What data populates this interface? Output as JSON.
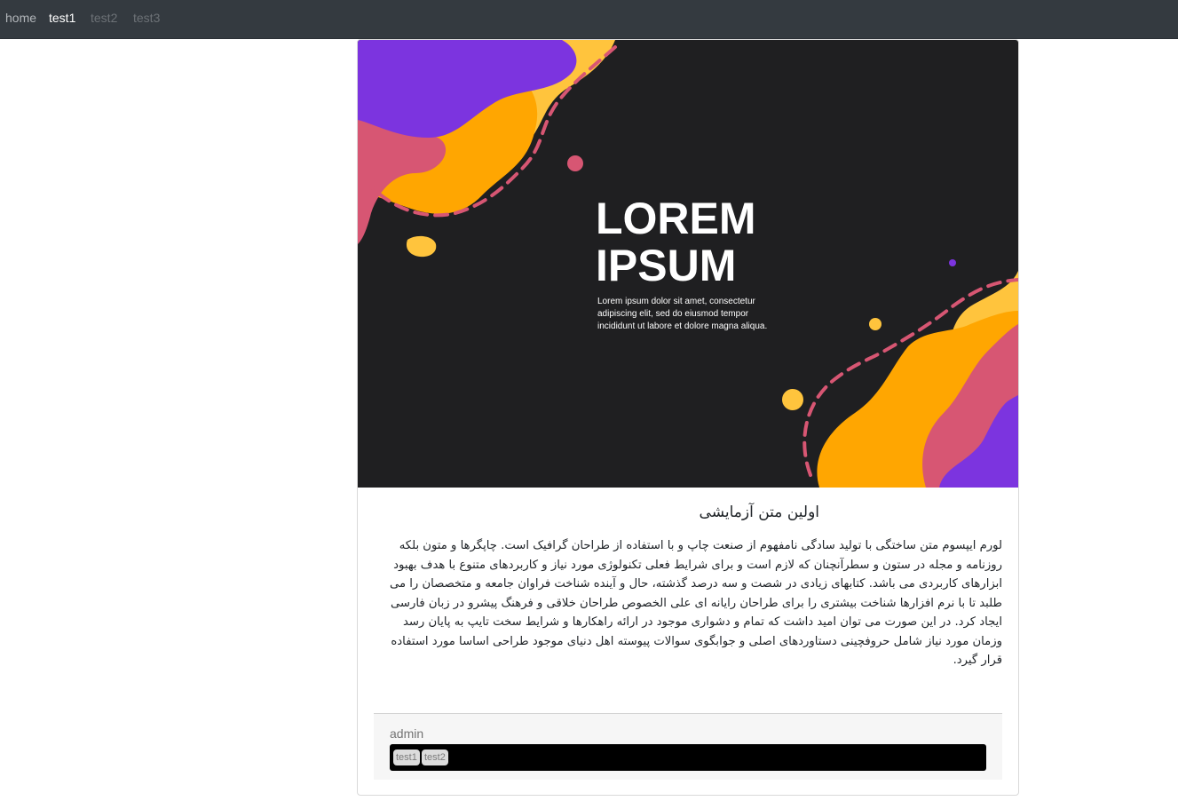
{
  "nav": {
    "home": "home",
    "items": [
      "test1",
      "test2",
      "test3"
    ]
  },
  "card": {
    "image": {
      "headline_1": "LOREM",
      "headline_2": "IPSUM",
      "caption": [
        "Lorem ipsum dolor sit amet, consectetur",
        "adipiscing elit, sed do eiusmod tempor",
        "incididunt ut labore et dolore magna aliqua."
      ],
      "colors": {
        "background": "#1f1f21",
        "purple": "#7c34df",
        "orange": "#ffa601",
        "yellow": "#ffc43d",
        "pink": "#d75673"
      }
    },
    "title": "اولین متن آزمایشی",
    "body": "لورم ایپسوم متن ساختگی با تولید سادگی نامفهوم از صنعت چاپ و با استفاده از طراحان گرافیک است. چاپگرها و متون بلکه روزنامه و مجله در ستون و سطرآنچنان که لازم است و برای شرایط فعلی تکنولوژی مورد نیاز و کاربردهای متنوع با هدف بهبود ابزارهای کاربردی می باشد. کتابهای زیادی در شصت و سه درصد گذشته، حال و آینده شناخت فراوان جامعه و متخصصان را می طلبد تا با نرم افزارها شناخت بیشتری را برای طراحان رایانه ای علی الخصوص طراحان خلاقی و فرهنگ پیشرو در زبان فارسی ایجاد کرد. در این صورت می توان امید داشت که تمام و دشواری موجود در ارائه راهکارها و شرایط سخت تایپ به پایان رسد وزمان مورد نیاز شامل حروفچینی دستاوردهای اصلی و جوابگوی سوالات پیوسته اهل دنیای موجود طراحی اساسا مورد استفاده قرار گیرد.",
    "footer": {
      "author": "admin",
      "tags": [
        "test1",
        "test2"
      ]
    }
  }
}
